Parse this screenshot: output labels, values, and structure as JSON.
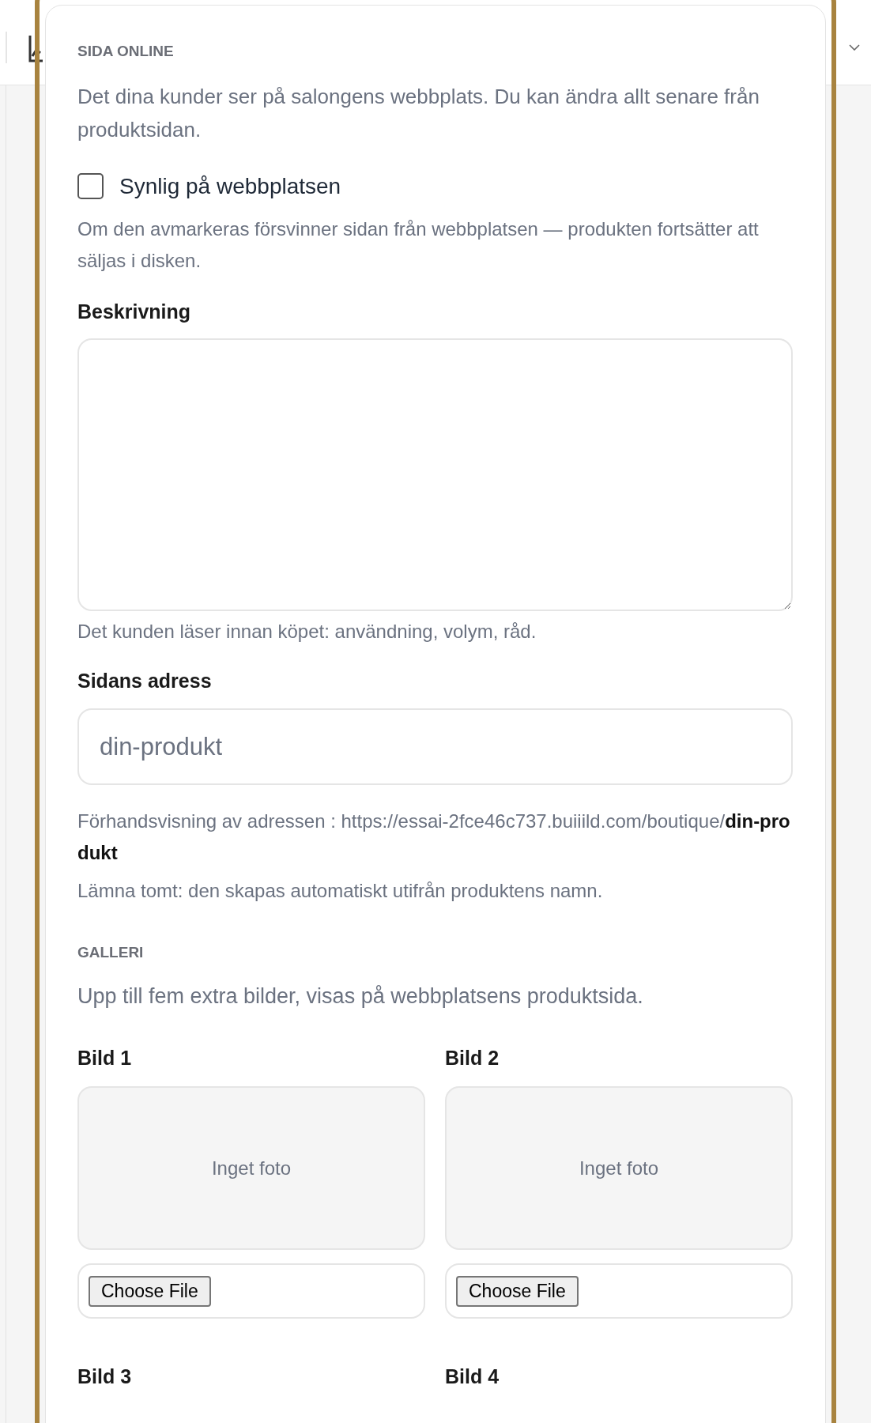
{
  "section": {
    "title": "SIDA ONLINE",
    "intro": "Det dina kunder ser på salongens webbplats. Du kan ändra allt senare från produktsidan."
  },
  "visible": {
    "label": "Synlig på webbplatsen",
    "checked": false,
    "help": "Om den avmarkeras försvinner sidan från webbplatsen — produkten fortsätter att säljas i disken."
  },
  "description": {
    "label": "Beskrivning",
    "help": "Det kunden läser innan köpet: användning, volym, råd."
  },
  "address": {
    "label": "Sidans adress",
    "placeholder": "din-produkt",
    "preview": "Förhandsvisning av adressen : https://essai-2fce46c737.buiiild.com/boutique/**din-produkt**",
    "help": "Lämna tomt: den skapas automatiskt utifrån produktens namn."
  },
  "gallery": {
    "title": "GALLERI",
    "intro": "Upp till fem extra bilder, visas på webbplatsens produktsida.",
    "images": [
      {
        "label": "Bild 1",
        "empty_text": "Inget foto",
        "file_button": "Choose File"
      },
      {
        "label": "Bild 2",
        "empty_text": "Inget foto",
        "file_button": "Choose File"
      },
      {
        "label": "Bild 3"
      },
      {
        "label": "Bild 4"
      }
    ]
  }
}
